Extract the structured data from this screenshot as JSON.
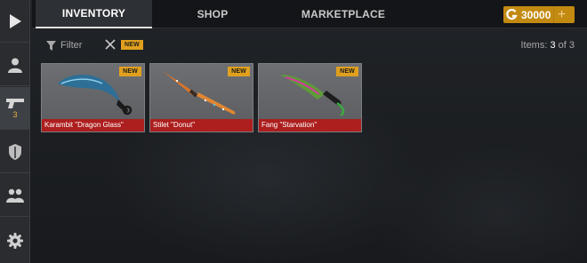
{
  "tabs": [
    {
      "label": "INVENTORY",
      "active": true
    },
    {
      "label": "SHOP",
      "active": false
    },
    {
      "label": "MARKETPLACE",
      "active": false
    }
  ],
  "currency": {
    "amount": "30000",
    "icon": "gold-coin-icon",
    "add_icon": "plus-icon"
  },
  "sidebar": {
    "items": [
      {
        "icon": "play-icon"
      },
      {
        "icon": "user-icon"
      },
      {
        "icon": "pistol-icon",
        "count": "3",
        "active": true
      },
      {
        "icon": "shield-icon"
      },
      {
        "icon": "group-icon"
      },
      {
        "icon": "gear-icon"
      }
    ]
  },
  "filter": {
    "label": "Filter",
    "badge": "NEW"
  },
  "items_count": {
    "prefix": "Items: ",
    "current": "3",
    "suffix": " of 3"
  },
  "items": [
    {
      "name": "Karambit \"Dragon Glass\"",
      "badge": "NEW",
      "icon": "karambit-knife-icon"
    },
    {
      "name": "Stilet \"Donut\"",
      "badge": "NEW",
      "icon": "stiletto-knife-icon"
    },
    {
      "name": "Fang \"Starvation\"",
      "badge": "NEW",
      "icon": "fang-knife-icon"
    }
  ],
  "colors": {
    "accent_gold": "#c38a12",
    "badge": "#e0a01e",
    "label_red": "#ad1e1e"
  }
}
